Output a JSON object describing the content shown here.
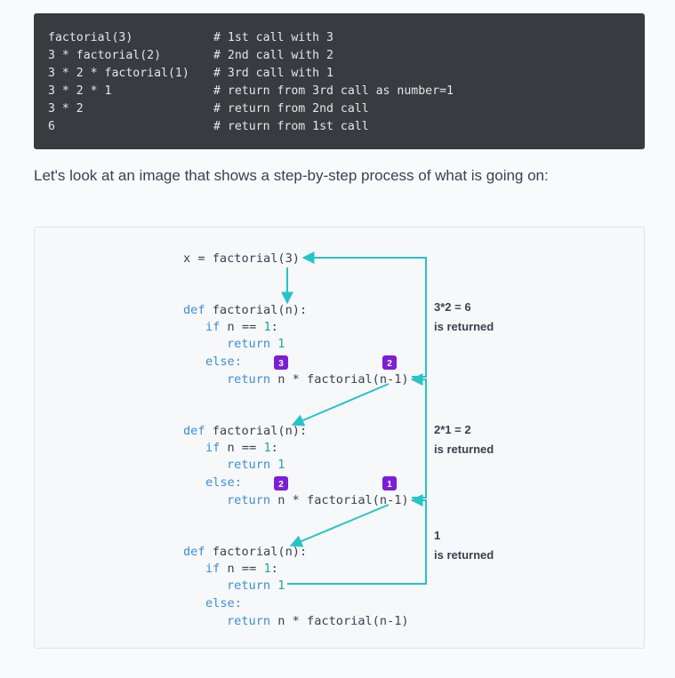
{
  "code_lines": [
    {
      "code": "factorial(3)",
      "comment": "# 1st call with 3"
    },
    {
      "code": "3 * factorial(2)",
      "comment": "# 2nd call with 2"
    },
    {
      "code": "3 * 2 * factorial(1)",
      "comment": "# 3rd call with 1"
    },
    {
      "code": "3 * 2 * 1",
      "comment": "# return from 3rd call as number=1"
    },
    {
      "code": "3 * 2",
      "comment": "# return from 2nd call"
    },
    {
      "code": "6",
      "comment": "# return from 1st call"
    }
  ],
  "intro_text": "Let's look at an image that shows a step-by-step process of what is going on:",
  "diagram": {
    "call_line": "x = factorial(3)",
    "def_line": "def factorial(n):",
    "if_kw": "if",
    "if_rest": " n == ",
    "if_one": "1",
    "if_colon": ":",
    "return_kw": "return",
    "return_one": " 1",
    "else_line": "else:",
    "return_rest": " n * factorial(n-1)",
    "blocks": [
      {
        "badge_left": "3",
        "badge_right": "2"
      },
      {
        "badge_left": "2",
        "badge_right": "1"
      }
    ],
    "annotations": [
      {
        "value": "3*2 = 6",
        "note": "is returned"
      },
      {
        "value": "2*1 = 2",
        "note": "is returned"
      },
      {
        "value": "1",
        "note": "is returned"
      }
    ],
    "colors": {
      "keyword": "#3a8fd8",
      "number": "#1aa89a",
      "text": "#3b3f50",
      "arrow": "#25c4c9",
      "badge": "#7a1fd6"
    }
  }
}
